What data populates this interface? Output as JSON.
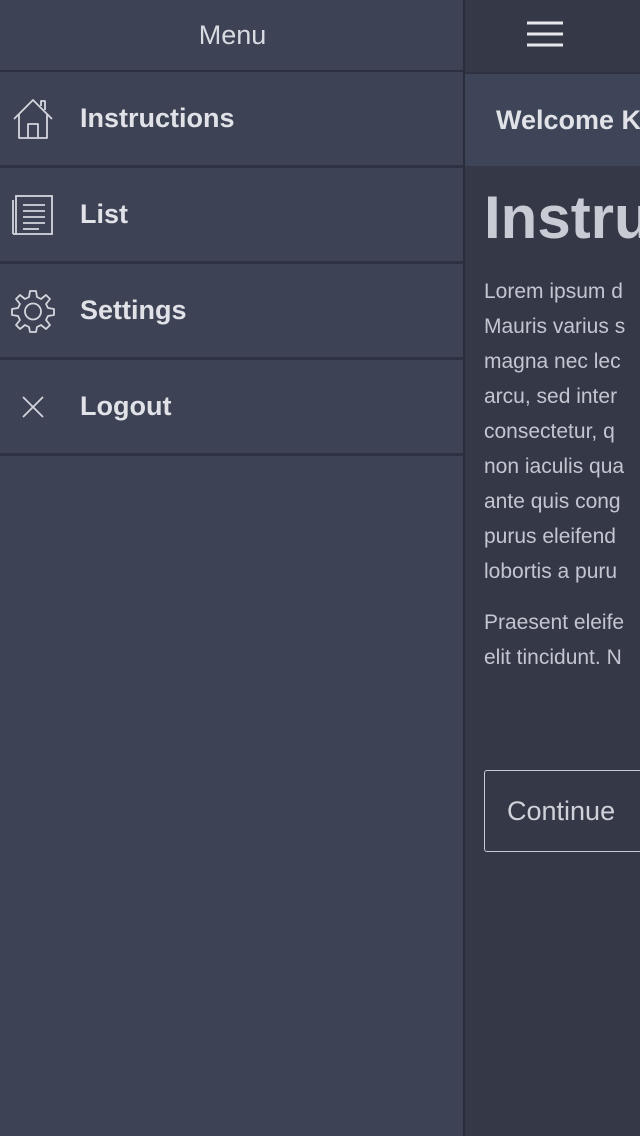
{
  "menu": {
    "title": "Menu",
    "items": [
      {
        "label": "Instructions",
        "icon": "home-icon"
      },
      {
        "label": "List",
        "icon": "list-icon"
      },
      {
        "label": "Settings",
        "icon": "gear-icon"
      },
      {
        "label": "Logout",
        "icon": "close-icon"
      }
    ]
  },
  "panel": {
    "welcome": "Welcome K",
    "heading": "Instru",
    "paragraph1": "Lorem ipsum d\nMauris varius s\nmagna nec lec\narcu, sed inter\nconsectetur, q\nnon iaculis qua\nante quis cong\npurus eleifend\nlobortis a puru",
    "paragraph2": "Praesent eleife\nelit tincidunt. N",
    "continue_label": "Continue"
  },
  "colors": {
    "menu_bg": "#3d4254",
    "panel_bg": "#353847",
    "welcome_bg": "#3f4558",
    "text": "#e0e2e8"
  }
}
